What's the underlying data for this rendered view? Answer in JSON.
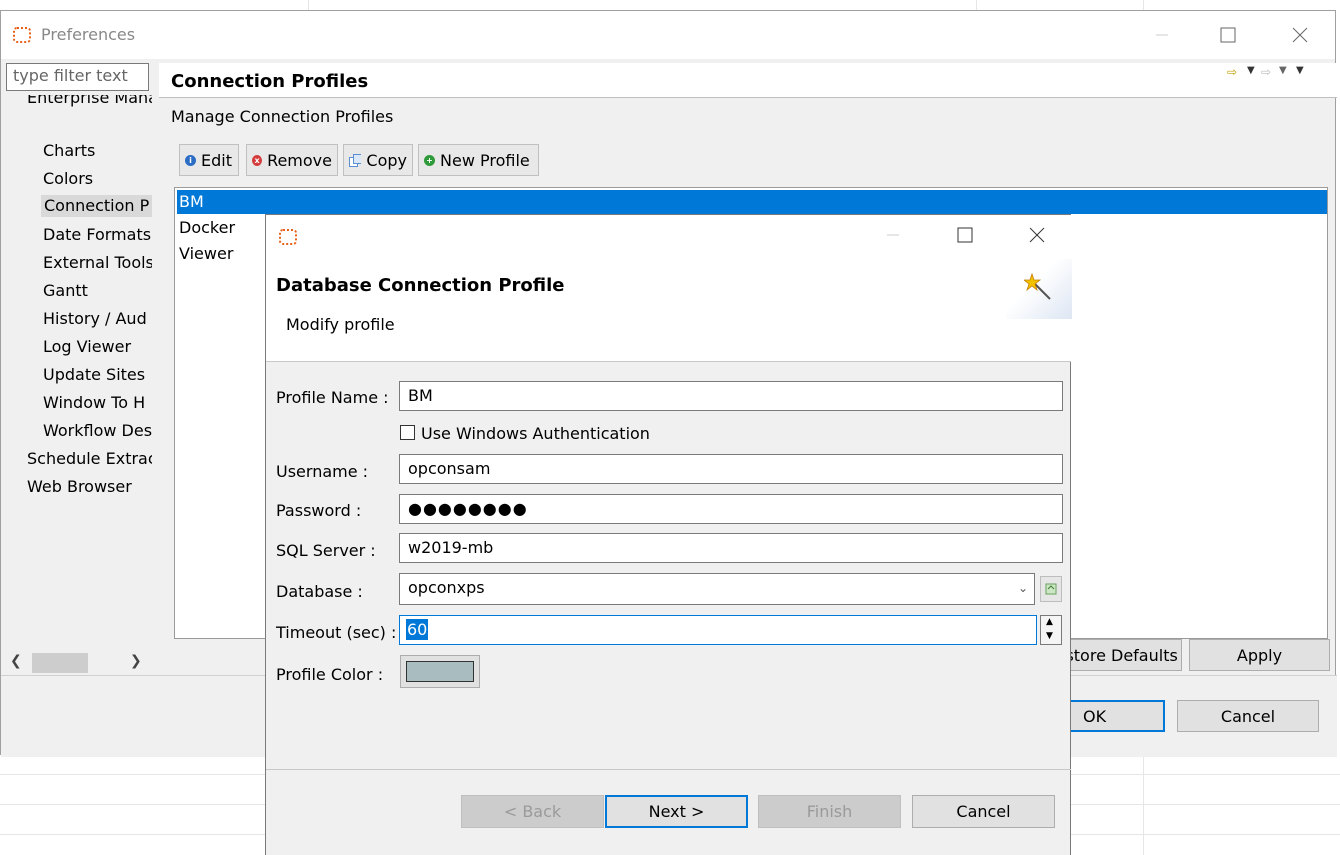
{
  "preferences": {
    "title": "Preferences",
    "filter_placeholder": "type filter text",
    "tree": [
      {
        "label": "Enterprise Mana",
        "level": 0
      },
      {
        "label": "Charts",
        "level": 1
      },
      {
        "label": "Colors",
        "level": 1
      },
      {
        "label": "Connection P",
        "level": 1,
        "selected": true
      },
      {
        "label": "Date Formats",
        "level": 1
      },
      {
        "label": "External Tools",
        "level": 1
      },
      {
        "label": "Gantt",
        "level": 1
      },
      {
        "label": "History / Aud",
        "level": 1
      },
      {
        "label": "Log Viewer",
        "level": 1
      },
      {
        "label": "Update Sites",
        "level": 1
      },
      {
        "label": "Window To H",
        "level": 1
      },
      {
        "label": "Workflow Des",
        "level": 1
      },
      {
        "label": "Schedule Extrac",
        "level": 0
      },
      {
        "label": "Web Browser",
        "level": 0
      }
    ],
    "page_title": "Connection Profiles",
    "page_subtitle": "Manage Connection Profiles",
    "toolbar": {
      "edit": "Edit",
      "remove": "Remove",
      "copy": "Copy",
      "new_profile": "New Profile"
    },
    "profiles": [
      {
        "name": "BM",
        "selected": true
      },
      {
        "name": "Docker"
      },
      {
        "name": "Viewer"
      }
    ],
    "restore_defaults": "Restore Defaults",
    "apply": "Apply",
    "ok": "OK",
    "cancel": "Cancel"
  },
  "dialog": {
    "title": "Database Connection Profile",
    "subtitle": "Modify profile",
    "profile_name_label": "Profile Name :",
    "profile_name_value": "BM",
    "windows_auth_label": "Use Windows Authentication",
    "windows_auth_checked": false,
    "username_label": "Username :",
    "username_value": "opconsam",
    "password_label": "Password :",
    "password_value": "●●●●●●●●",
    "sql_server_label": "SQL Server :",
    "sql_server_value": "w2019-mb",
    "database_label": "Database :",
    "database_value": "opconxps",
    "timeout_label": "Timeout (sec) :",
    "timeout_value": "60",
    "color_label": "Profile Color :",
    "profile_color": "#a9bcc0",
    "buttons": {
      "back": "< Back",
      "next": "Next >",
      "finish": "Finish",
      "cancel": "Cancel"
    }
  },
  "colors": {
    "selection": "#0078d7",
    "app_icon": "#e8611a"
  }
}
